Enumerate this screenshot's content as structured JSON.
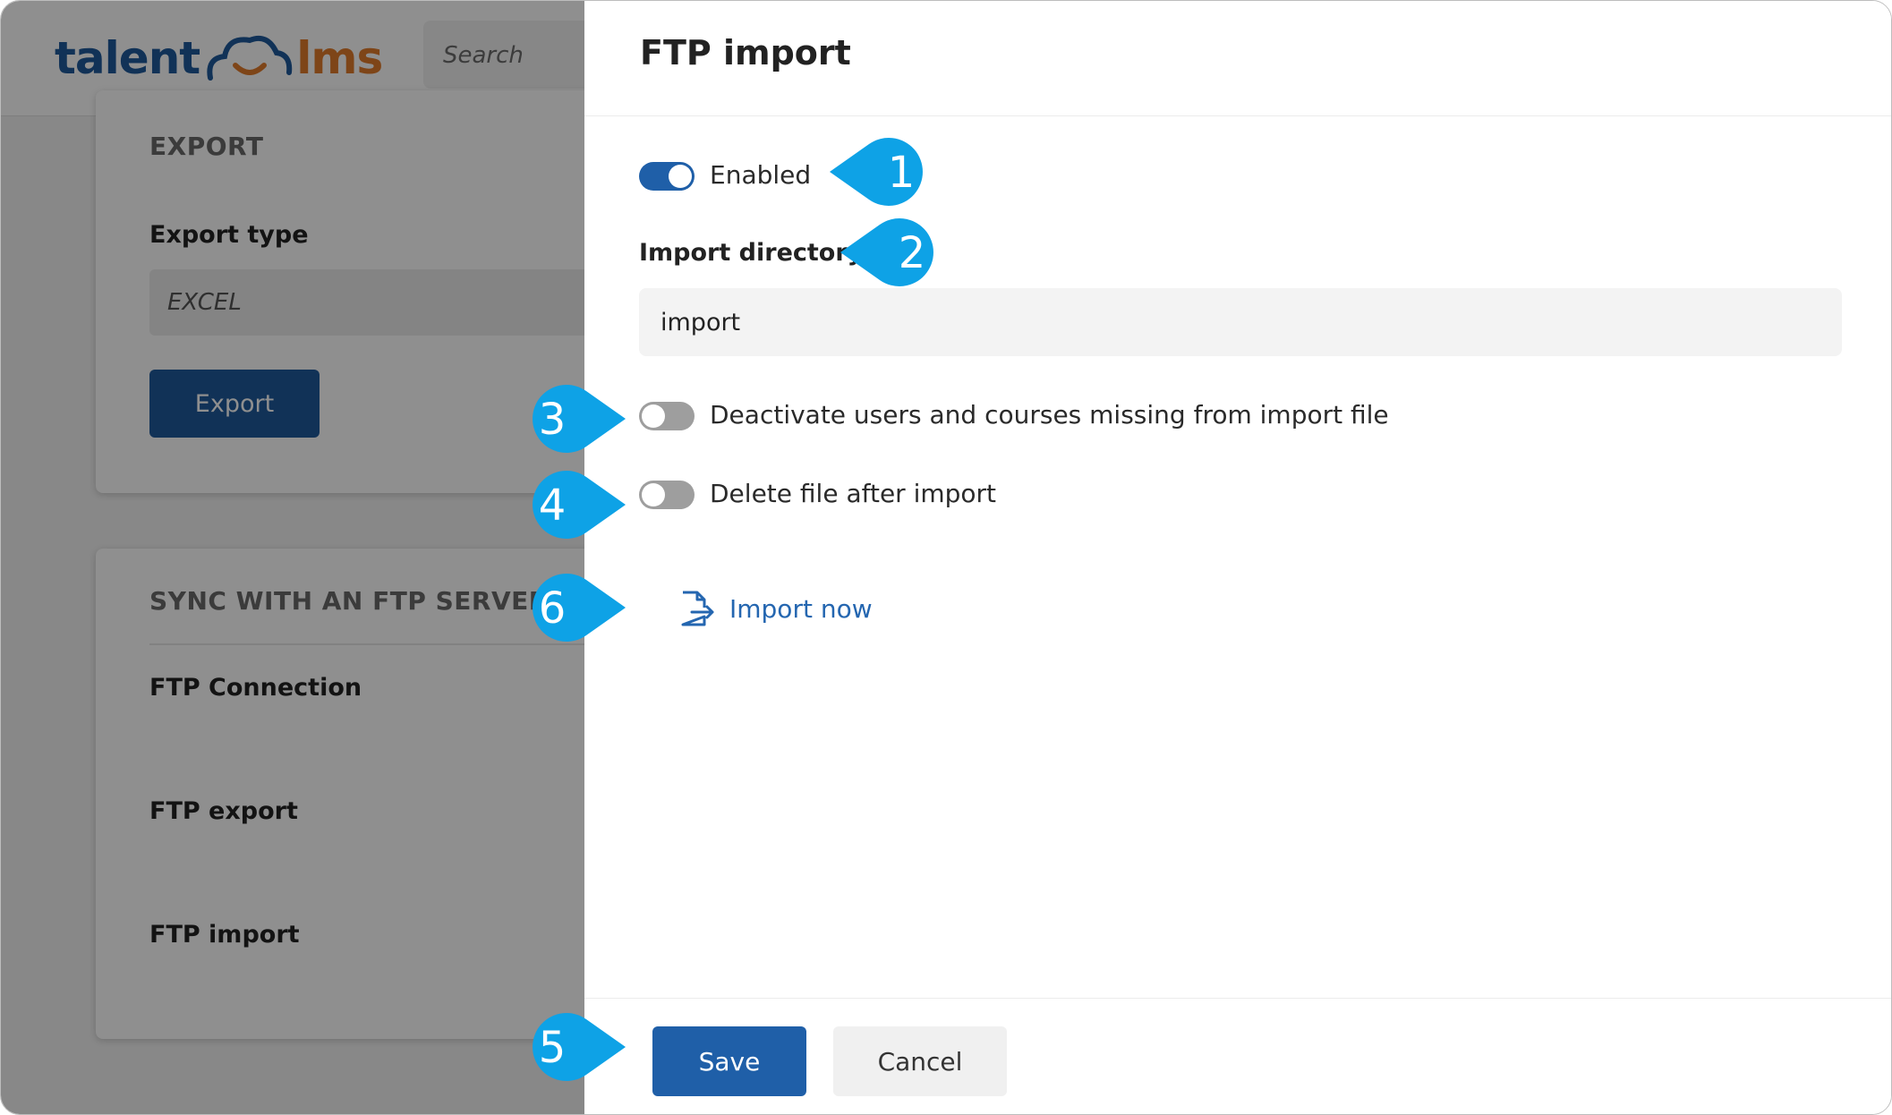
{
  "colors": {
    "brand_blue": "#1f5fa8",
    "brand_orange": "#e07b2c",
    "callout_blue": "#0ea2e6",
    "link_blue": "#2466b0"
  },
  "background_app": {
    "logo": {
      "left": "talent",
      "right": "lms",
      "icon": "cloud-smile-icon"
    },
    "search_placeholder": "Search",
    "export_card": {
      "title": "EXPORT",
      "export_type_label": "Export type",
      "export_type_value": "EXCEL",
      "export_button": "Export"
    },
    "ftp_card": {
      "title": "SYNC WITH AN FTP SERVER",
      "items": [
        "FTP Connection",
        "FTP export",
        "FTP import"
      ]
    }
  },
  "drawer": {
    "title": "FTP import",
    "enabled": {
      "label": "Enabled",
      "checked": true
    },
    "import_directory": {
      "label": "Import directory",
      "value": "import"
    },
    "deactivate": {
      "label": "Deactivate users and courses missing from import file",
      "checked": false
    },
    "delete_file": {
      "label": "Delete file after import",
      "checked": false
    },
    "import_now": {
      "label": "Import now",
      "icon": "file-import-icon"
    },
    "footer": {
      "save": "Save",
      "cancel": "Cancel"
    }
  },
  "callouts": [
    "1",
    "2",
    "3",
    "4",
    "6",
    "5"
  ]
}
